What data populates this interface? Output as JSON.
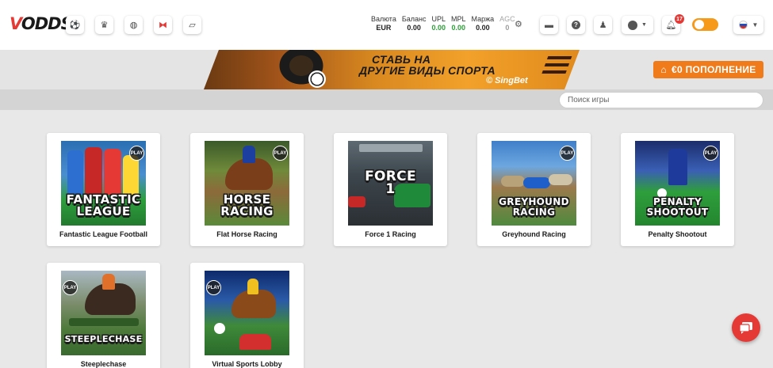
{
  "header": {
    "logo_prefix": "V",
    "logo_rest": "ODDS",
    "nav_icons": [
      {
        "name": "soccer-icon",
        "glyph": "⚽"
      },
      {
        "name": "crown-icon",
        "glyph": "♛"
      },
      {
        "name": "globe-icon",
        "glyph": "◍"
      },
      {
        "name": "gamepad-icon",
        "glyph": "⧓"
      },
      {
        "name": "ticket-icon",
        "glyph": "▱"
      }
    ],
    "stats": [
      {
        "label": "Валюта",
        "value": "EUR",
        "color": "#222222"
      },
      {
        "label": "Баланс",
        "value": "0.00",
        "color": "#222222"
      },
      {
        "label": "UPL",
        "value": "0.00",
        "color": "#2e9d3a"
      },
      {
        "label": "MPL",
        "value": "0.00",
        "color": "#2e9d3a"
      },
      {
        "label": "Маржа",
        "value": "0.00",
        "color": "#222222"
      },
      {
        "label": "AGC",
        "value": "0",
        "color": "#222222"
      }
    ],
    "notification_count": "17"
  },
  "banner": {
    "line1": "СТАВЬ НА",
    "line2": "ДРУГИЕ ВИДЫ СПОРТА",
    "brand": "© SingBet",
    "deposit_label": "€0  ПОПОЛНЕНИЕ"
  },
  "search": {
    "placeholder": "Поиск игры"
  },
  "games": [
    {
      "label": "Fantastic League Football",
      "title_line1": "FANTASTIC",
      "title_line2": "LEAGUE",
      "badge": "PLAY"
    },
    {
      "label": "Flat Horse Racing",
      "title_line1": "HORSE",
      "title_line2": "RACING",
      "badge": "PLAY"
    },
    {
      "label": "Force 1 Racing",
      "title_line1": "FORCE",
      "title_line2": "1",
      "badge": ""
    },
    {
      "label": "Greyhound Racing",
      "title_line1": "GREYHOUND",
      "title_line2": "RACING",
      "badge": "PLAY"
    },
    {
      "label": "Penalty Shootout",
      "title_line1": "PENALTY",
      "title_line2": "SHOOTOUT",
      "badge": "PLAY"
    },
    {
      "label": "Steeplechase",
      "title_line1": "STEEPLECHASE",
      "title_line2": "",
      "badge": "PLAY"
    },
    {
      "label": "Virtual Sports Lobby",
      "title_line1": "",
      "title_line2": "",
      "badge": "PLAY"
    }
  ],
  "colors": {
    "accent_orange": "#f07b1a",
    "brand_red": "#e53935",
    "positive_green": "#2e9d3a"
  }
}
